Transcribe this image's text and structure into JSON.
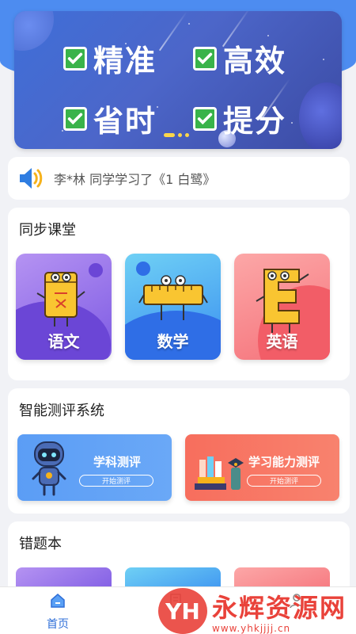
{
  "banner": {
    "slogans": [
      "精准",
      "高效",
      "省时",
      "提分"
    ],
    "colors": {
      "check": "#39b34a",
      "dots": "#fbd64a"
    }
  },
  "notice": {
    "icon": "speaker-icon",
    "text": "李*林 同学学习了《1 白鹭》"
  },
  "sync_class": {
    "title": "同步课堂",
    "subjects": [
      {
        "label": "语文",
        "icon": "notebook-mascot-icon"
      },
      {
        "label": "数学",
        "icon": "ruler-mascot-icon"
      },
      {
        "label": "英语",
        "icon": "letter-e-mascot-icon"
      }
    ]
  },
  "assessment": {
    "title": "智能测评系统",
    "items": [
      {
        "title": "学科测评",
        "button": "开始测评",
        "icon": "robot-icon"
      },
      {
        "title": "学习能力测评",
        "button": "开始测评",
        "icon": "books-icon"
      }
    ]
  },
  "wrong_book": {
    "title": "错题本"
  },
  "tabbar": {
    "tabs": [
      {
        "label": "首页",
        "icon": "home-icon",
        "active": true
      },
      {
        "label": "",
        "icon": "book-icon",
        "active": false
      },
      {
        "label": "",
        "icon": "person-icon",
        "active": false
      }
    ]
  },
  "watermark": {
    "logo": "YH",
    "name": "永辉资源网",
    "url": "www.yhkjjjj.cn"
  }
}
